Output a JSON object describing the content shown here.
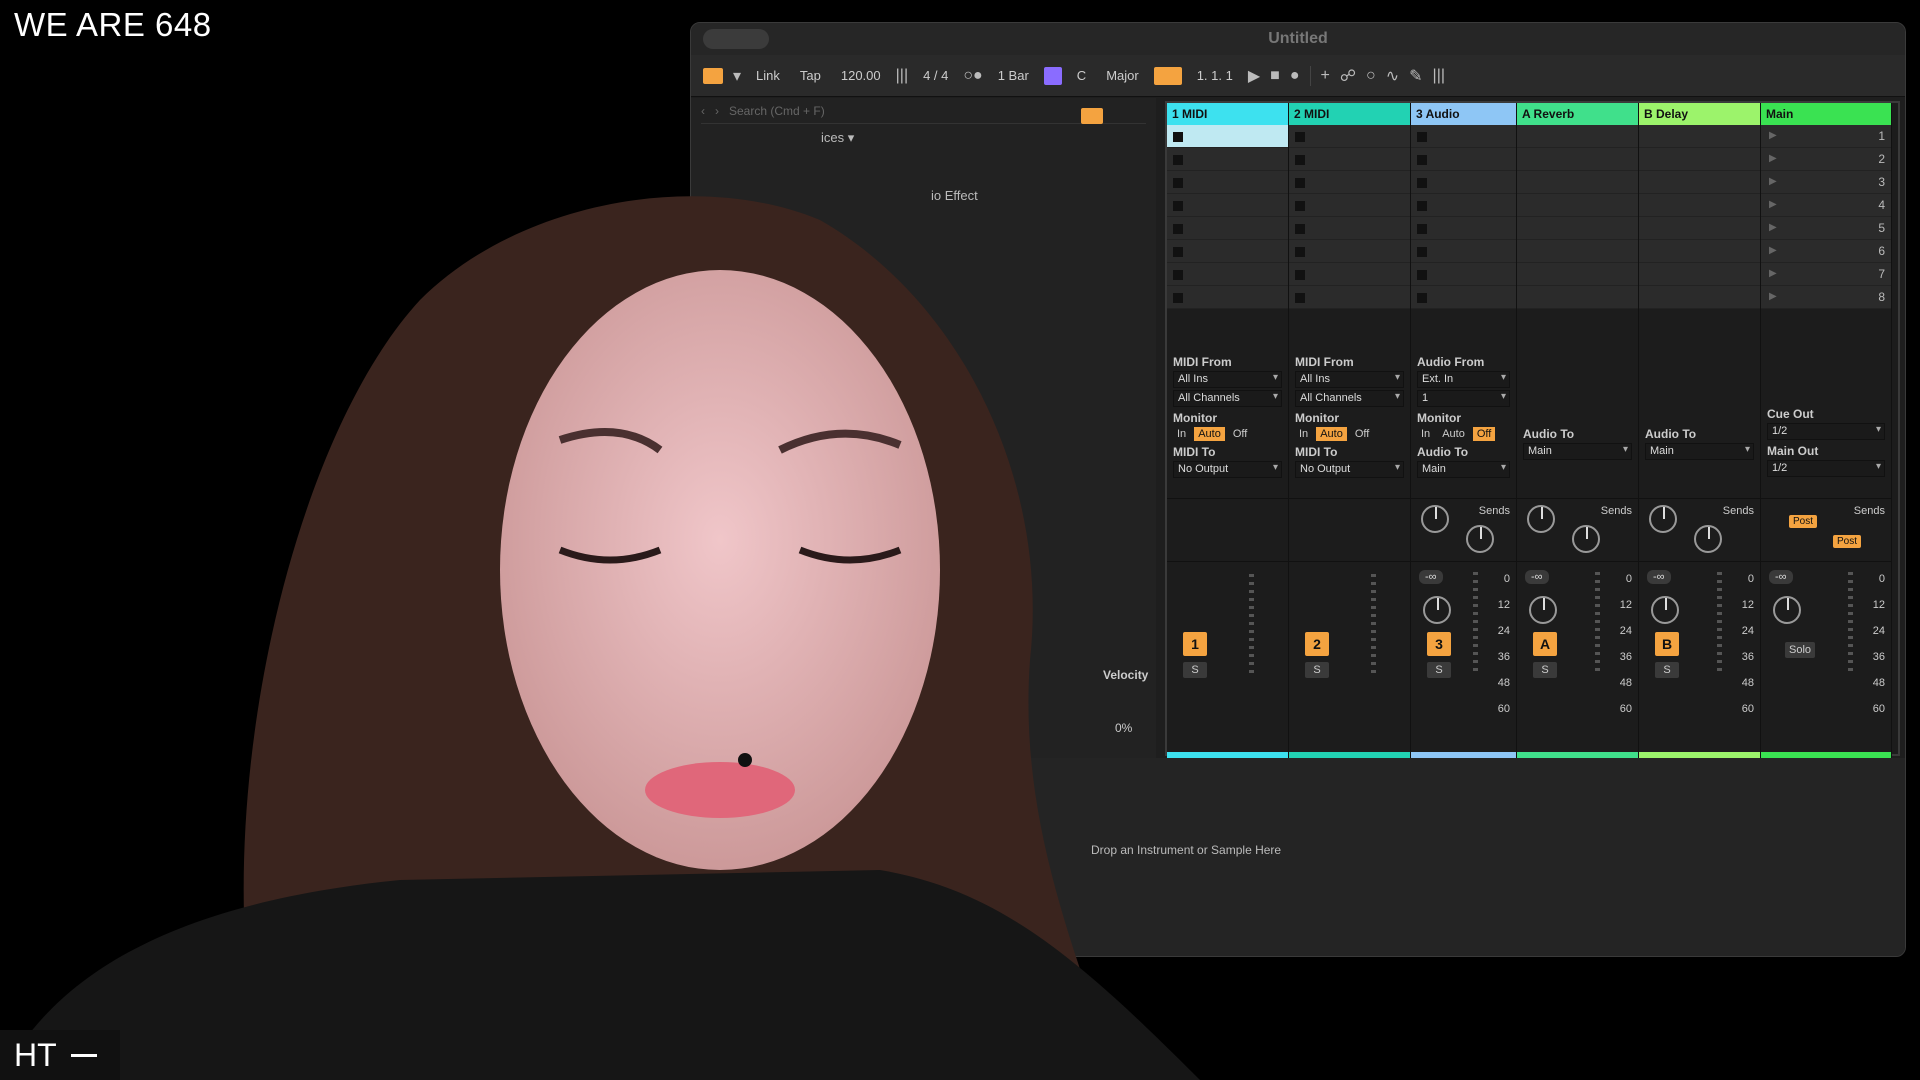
{
  "overlay": {
    "stream_title": "WE ARE 648",
    "logo_text": "HT"
  },
  "window": {
    "title": "Untitled"
  },
  "toolbar": {
    "link": "Link",
    "tap": "Tap",
    "tempo": "120.00",
    "signature": "4 / 4",
    "quantize": "1 Bar",
    "key": "C",
    "scale": "Major",
    "position": "1.  1.  1"
  },
  "browser": {
    "search_placeholder": "Search (Cmd + F)",
    "partial_item_1": "ices ▾",
    "partial_item_2": "io Effect"
  },
  "tracks": [
    {
      "name": "1 MIDI",
      "color": "#3de1ef",
      "num": "1",
      "io_from_label": "MIDI From",
      "from": "All Ins",
      "channel": "All Channels",
      "to_label": "MIDI To",
      "to": "No Output",
      "monitor": [
        "In",
        "Auto",
        "Off"
      ],
      "monitor_on": "Auto"
    },
    {
      "name": "2 MIDI",
      "color": "#22d2b3",
      "num": "2",
      "io_from_label": "MIDI From",
      "from": "All Ins",
      "channel": "All Channels",
      "to_label": "MIDI To",
      "to": "No Output",
      "monitor": [
        "In",
        "Auto",
        "Off"
      ],
      "monitor_on": "Auto"
    },
    {
      "name": "3 Audio",
      "color": "#8ec6f5",
      "num": "3",
      "io_from_label": "Audio From",
      "from": "Ext. In",
      "channel": "1",
      "to_label": "Audio To",
      "to": "Main",
      "monitor": [
        "In",
        "Auto",
        "Off"
      ],
      "monitor_on": "Off"
    },
    {
      "name": "A Reverb",
      "color": "#40e08b",
      "num": "A",
      "to_label": "Audio To",
      "to": "Main"
    },
    {
      "name": "B Delay",
      "color": "#9cf36b",
      "num": "B",
      "to_label": "Audio To",
      "to": "Main"
    },
    {
      "name": "Main",
      "color": "#3ae252",
      "cue_out_label": "Cue Out",
      "cue_out": "1/2",
      "main_out_label": "Main Out",
      "main_out": "1/2"
    }
  ],
  "scene_numbers": [
    "1",
    "2",
    "3",
    "4",
    "5",
    "6",
    "7",
    "8"
  ],
  "mixer": {
    "sends_label": "Sends",
    "send_a": "A",
    "send_b": "B",
    "post": "Post",
    "solo_btn": "S",
    "solo_label": "Solo",
    "neg_inf": "-∞",
    "scale": [
      "0",
      "12",
      "24",
      "36",
      "48",
      "60"
    ]
  },
  "detail": {
    "velocity_label": "Velocity",
    "velocity_value": "0.0",
    "percent": "0%",
    "drop_hint": "Drop an Instrument or Sample Here"
  }
}
